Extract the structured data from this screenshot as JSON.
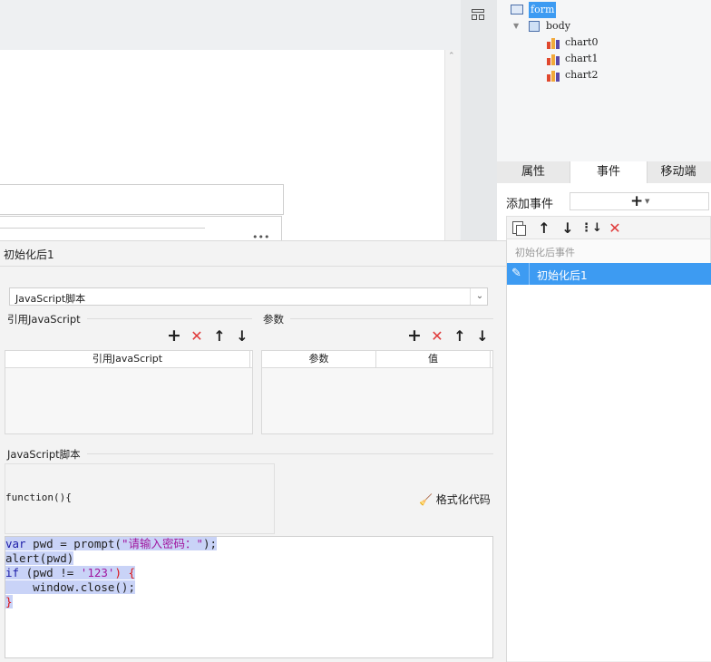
{
  "tree": {
    "root": "form",
    "body": "body",
    "charts": [
      "chart0",
      "chart1",
      "chart2"
    ]
  },
  "tabs": [
    "属性",
    "事件",
    "移动端"
  ],
  "events": {
    "add_label": "添加事件",
    "group_header": "初始化后事件",
    "items": [
      "初始化后1"
    ]
  },
  "dialog": {
    "title": "初始化后1",
    "type_select": "JavaScript脚本",
    "ref_js_section": "引用JavaScript",
    "params_section": "参数",
    "ref_js_column": "引用JavaScript",
    "param_columns": [
      "参数",
      "值"
    ],
    "script_section": "JavaScript脚本",
    "function_header": "function(){",
    "format_label": "格式化代码"
  },
  "code": {
    "line1": {
      "kw": "var",
      "rest1": " pwd = prompt(",
      "str": "\"请输入密码：\"",
      "rest2": ");"
    },
    "line2": "alert(pwd)",
    "line3": {
      "kw": "if",
      "rest1": " (pwd != ",
      "str": "'123'",
      "rest2": ") {"
    },
    "line4": "    window.close();",
    "line5": "}"
  },
  "colors": {
    "accent": "#3d9bf2",
    "delete": "#e03a3a",
    "selection": "#c9d3f7"
  }
}
